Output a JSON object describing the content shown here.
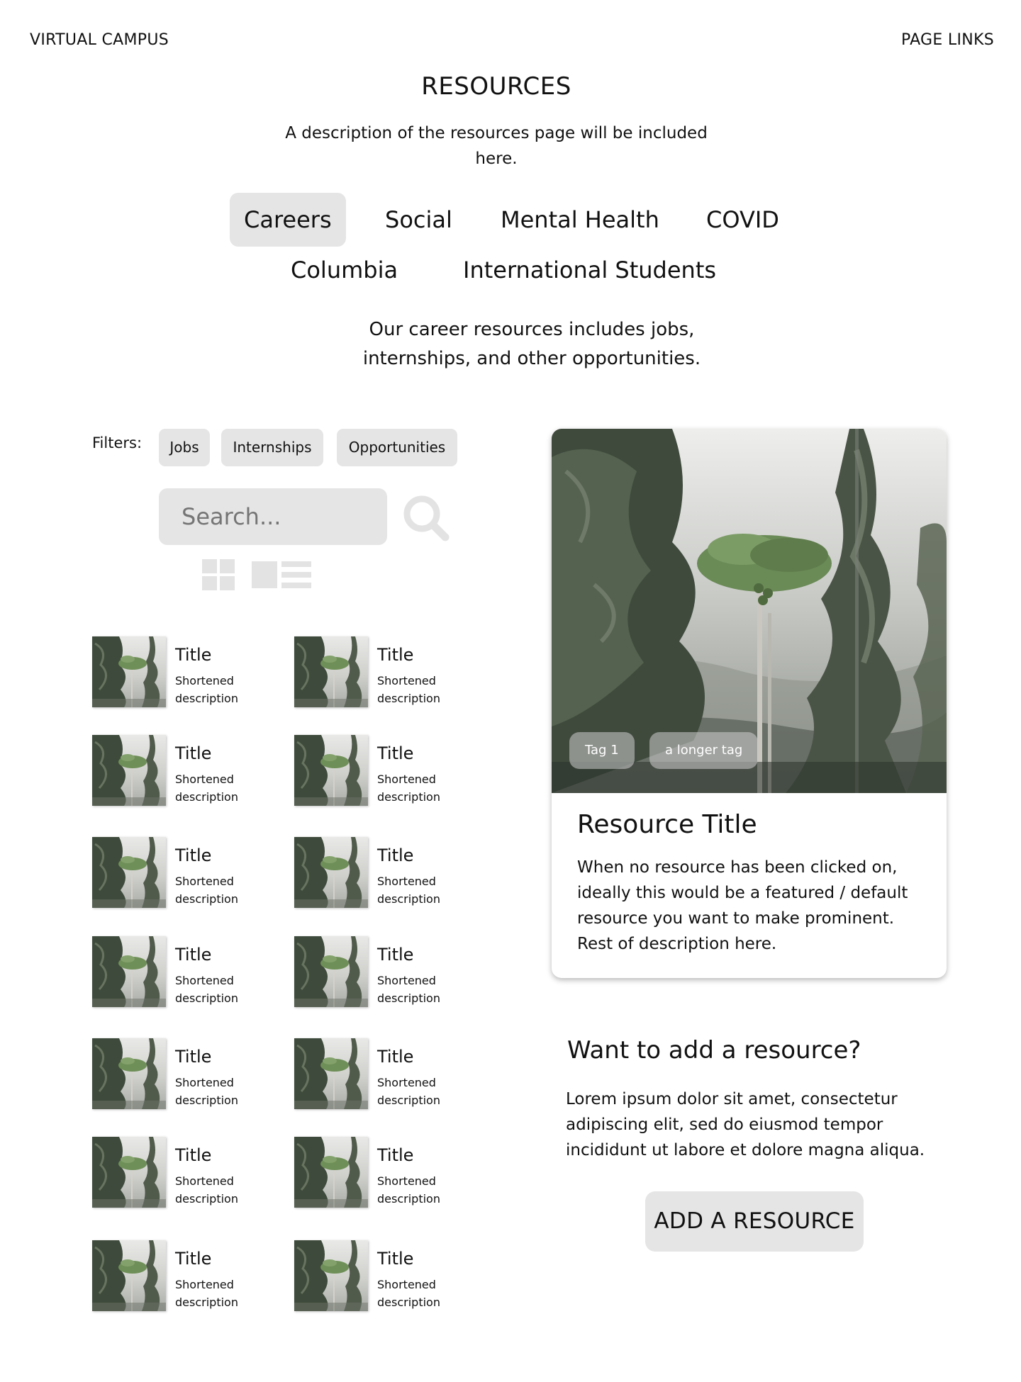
{
  "header": {
    "site_name": "VIRTUAL CAMPUS",
    "page_links": "PAGE LINKS"
  },
  "page": {
    "title": "RESOURCES",
    "description": "A description of the resources page will be included here."
  },
  "tabs": [
    {
      "label": "Careers",
      "active": true
    },
    {
      "label": "Social",
      "active": false
    },
    {
      "label": "Mental Health",
      "active": false
    },
    {
      "label": "COVID",
      "active": false
    },
    {
      "label": "Columbia",
      "active": false
    },
    {
      "label": "International Students",
      "active": false
    }
  ],
  "category_description": "Our career resources includes jobs, internships, and other opportunities.",
  "filters": {
    "label": "Filters:",
    "chips": [
      "Jobs",
      "Internships",
      "Opportunities"
    ]
  },
  "search": {
    "placeholder": "Search..."
  },
  "view_toggles": {
    "grid_icon": "grid-icon",
    "list_icon": "list-icon"
  },
  "resources": [
    {
      "title": "Title",
      "description": "Shortened description"
    },
    {
      "title": "Title",
      "description": "Shortened description"
    },
    {
      "title": "Title",
      "description": "Shortened description"
    },
    {
      "title": "Title",
      "description": "Shortened description"
    },
    {
      "title": "Title",
      "description": "Shortened description"
    },
    {
      "title": "Title",
      "description": "Shortened description"
    },
    {
      "title": "Title",
      "description": "Shortened description"
    },
    {
      "title": "Title",
      "description": "Shortened description"
    },
    {
      "title": "Title",
      "description": "Shortened description"
    },
    {
      "title": "Title",
      "description": "Shortened description"
    },
    {
      "title": "Title",
      "description": "Shortened description"
    },
    {
      "title": "Title",
      "description": "Shortened description"
    },
    {
      "title": "Title",
      "description": "Shortened description"
    },
    {
      "title": "Title",
      "description": "Shortened description"
    }
  ],
  "featured": {
    "tags": [
      "Tag 1",
      "a longer tag"
    ],
    "title": "Resource Title",
    "description": "When no resource has been clicked on, ideally this would be a featured / default resource you want to make prominent. Rest of description here."
  },
  "add_resource": {
    "heading": "Want to add a resource?",
    "text": "Lorem ipsum dolor sit amet, consectetur adipiscing elit, sed do eiusmod tempor incididunt ut labore et dolore magna aliqua.",
    "button_label": "ADD A RESOURCE"
  },
  "colors": {
    "chip_background": "#e5e5e5",
    "text": "#111111",
    "icon_gray": "#e3e3e3"
  }
}
